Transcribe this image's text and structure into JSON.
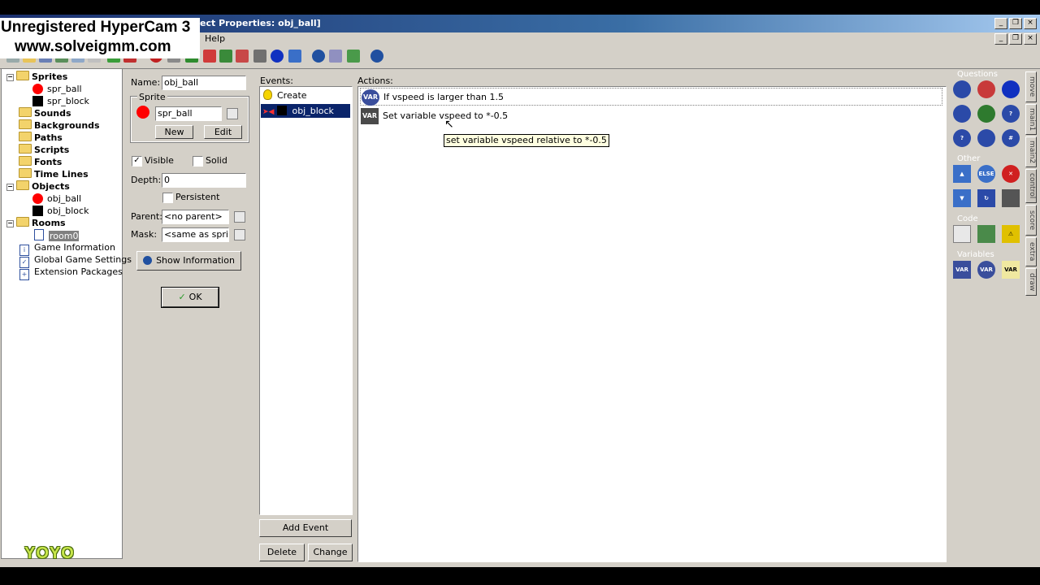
{
  "watermark": {
    "line1": "Unregistered HyperCam 3",
    "line2": "www.solveigmm.com"
  },
  "window": {
    "title": "ect Properties: obj_ball]",
    "menu_help": "Help"
  },
  "tree": {
    "sprites": "Sprites",
    "spr_ball": "spr_ball",
    "spr_block": "spr_block",
    "sounds": "Sounds",
    "backgrounds": "Backgrounds",
    "paths": "Paths",
    "scripts": "Scripts",
    "fonts": "Fonts",
    "timelines": "Time Lines",
    "objects": "Objects",
    "obj_ball": "obj_ball",
    "obj_block": "obj_block",
    "rooms": "Rooms",
    "room0": "room0",
    "game_info": "Game Information",
    "global_settings": "Global Game Settings",
    "extensions": "Extension Packages"
  },
  "logo": "YOYO",
  "props": {
    "name_label": "Name:",
    "name_value": "obj_ball",
    "sprite_label": "Sprite",
    "sprite_value": "spr_ball",
    "new_label": "New",
    "edit_label": "Edit",
    "visible_label": "Visible",
    "solid_label": "Solid",
    "depth_label": "Depth:",
    "depth_value": "0",
    "persistent_label": "Persistent",
    "parent_label": "Parent:",
    "parent_value": "<no parent>",
    "mask_label": "Mask:",
    "mask_value": "<same as sprite>",
    "show_info_label": "Show Information",
    "ok_label": "OK"
  },
  "events": {
    "label": "Events:",
    "items": [
      "Create",
      "obj_block"
    ],
    "add_label": "Add Event",
    "delete_label": "Delete",
    "change_label": "Change"
  },
  "actions": {
    "label": "Actions:",
    "items": [
      "If vspeed is larger than 1.5",
      "Set variable vspeed to *-0.5"
    ],
    "tooltip": "set variable vspeed relative to *-0.5"
  },
  "palette": {
    "questions": "Questions",
    "other": "Other",
    "code": "Code",
    "variables": "Variables",
    "tabs": [
      "move",
      "main1",
      "main2",
      "control",
      "score",
      "extra",
      "draw"
    ]
  }
}
